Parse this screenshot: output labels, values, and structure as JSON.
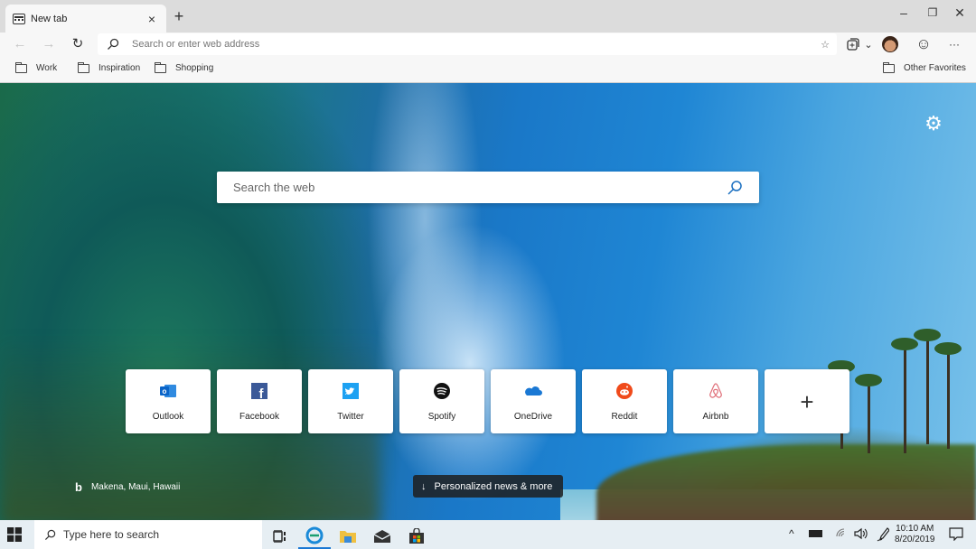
{
  "browser": {
    "tab": {
      "label": "New tab",
      "icon": "newtab-icon"
    },
    "new_tab_symbol": "+",
    "close_tab_symbol": "×",
    "window_controls": {
      "minimize": "–",
      "restore": "❐",
      "close": "✕"
    },
    "nav": {
      "back": "←",
      "forward": "→",
      "refresh": "↻"
    },
    "address_bar": {
      "placeholder": "Search or enter web address",
      "favorite_symbol": "☆"
    },
    "toolbar_icons": [
      "collections-icon",
      "chevron-down-icon",
      "profile-avatar",
      "feedback-smiley-icon",
      "more-menu-icon"
    ],
    "more_symbol": "···",
    "smiley_symbol": "☺",
    "chevron_symbol": "⌄",
    "favorites": [
      {
        "label": "Work"
      },
      {
        "label": "Inspiration"
      },
      {
        "label": "Shopping"
      }
    ],
    "other_favorites": "Other Favorites"
  },
  "newtab": {
    "settings_symbol": "⚙",
    "search_placeholder": "Search the web",
    "tiles": [
      {
        "label": "Outlook",
        "icon": "outlook-icon",
        "color": "#0a64c8"
      },
      {
        "label": "Facebook",
        "icon": "facebook-icon",
        "color": "#3b5998"
      },
      {
        "label": "Twitter",
        "icon": "twitter-icon",
        "color": "#1da1f2"
      },
      {
        "label": "Spotify",
        "icon": "spotify-icon",
        "color": "#111111"
      },
      {
        "label": "OneDrive",
        "icon": "onedrive-icon",
        "color": "#1a78d4"
      },
      {
        "label": "Reddit",
        "icon": "reddit-icon",
        "color": "#f04a1a"
      },
      {
        "label": "Airbnb",
        "icon": "airbnb-icon",
        "color": "#e0707a"
      },
      {
        "label": "",
        "icon": "add-site-icon",
        "symbol": "+"
      }
    ],
    "image_credit": {
      "logo": "b",
      "location": "Makena, Maui, Hawaii"
    },
    "news_button": {
      "arrow": "↓",
      "label": "Personalized news & more"
    }
  },
  "taskbar": {
    "search_placeholder": "Type here to search",
    "apps": [
      "task-view-icon",
      "edge-icon",
      "file-explorer-icon",
      "mail-icon",
      "store-icon"
    ],
    "tray": {
      "chevron": "^",
      "volume": "🔈"
    },
    "clock": {
      "time": "10:10 AM",
      "date": "8/20/2019"
    }
  }
}
